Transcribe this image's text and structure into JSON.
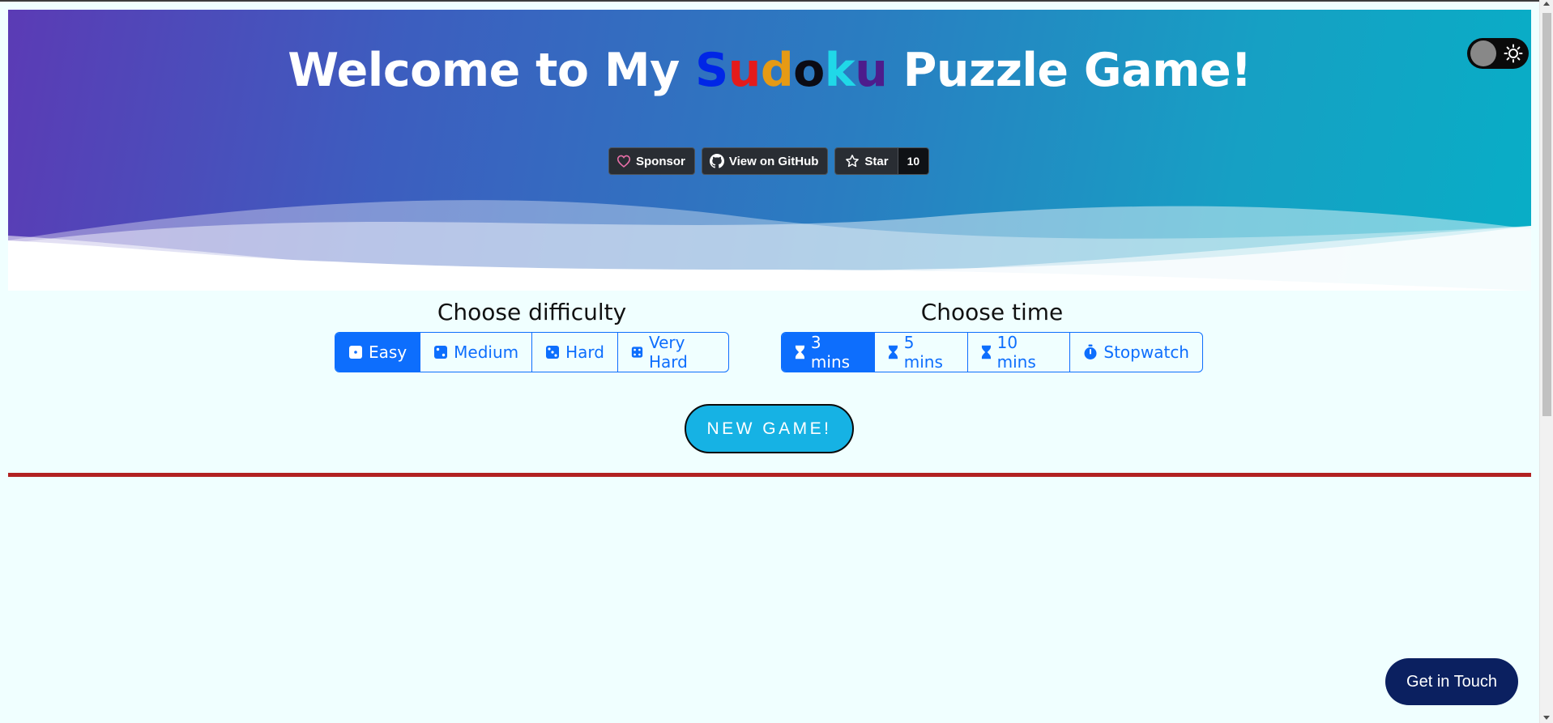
{
  "header": {
    "title_before": "Welcome to My ",
    "title_letters": [
      "S",
      "u",
      "d",
      "o",
      "k",
      "u"
    ],
    "title_after": " Puzzle Game!",
    "letter_colors": [
      "#0026e6",
      "#e41b1b",
      "#e69a14",
      "#0b0b14",
      "#20d8e8",
      "#4d1c8c"
    ],
    "badges": {
      "sponsor_label": "Sponsor",
      "github_label": "View on GitHub",
      "star_label": "Star",
      "star_count": "10"
    },
    "theme_toggle": {
      "state": "light",
      "icon": "sun-icon"
    }
  },
  "difficulty": {
    "label": "Choose difficulty",
    "options": [
      {
        "label": "Easy",
        "icon": "dice-1-icon",
        "active": true
      },
      {
        "label": "Medium",
        "icon": "dice-2-icon",
        "active": false
      },
      {
        "label": "Hard",
        "icon": "dice-3-icon",
        "active": false
      },
      {
        "label": "Very Hard",
        "icon": "dice-4-icon",
        "active": false
      }
    ]
  },
  "time": {
    "label": "Choose time",
    "options": [
      {
        "label": "3 mins",
        "icon": "hourglass-icon",
        "active": true
      },
      {
        "label": "5 mins",
        "icon": "hourglass-icon",
        "active": false
      },
      {
        "label": "10 mins",
        "icon": "hourglass-icon",
        "active": false
      },
      {
        "label": "Stopwatch",
        "icon": "stopwatch-icon",
        "active": false
      }
    ]
  },
  "actions": {
    "new_game_label": "NEW GAME!",
    "contact_label": "Get in Touch"
  },
  "colors": {
    "accent": "#0d6efd",
    "new_game_bg": "#16b2e4",
    "divider": "#b22222",
    "contact_bg": "#0b2060",
    "page_bg": "#f0ffff"
  }
}
